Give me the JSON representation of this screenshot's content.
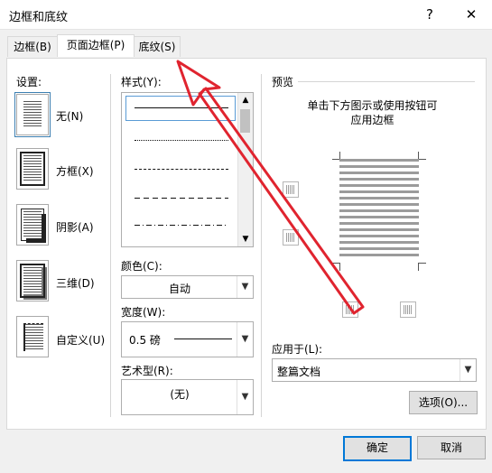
{
  "window": {
    "title": "边框和底纹",
    "help_label": "?",
    "close_label": "✕"
  },
  "tabs": [
    {
      "label": "边框(B)"
    },
    {
      "label": "页面边框(P)"
    },
    {
      "label": "底纹(S)"
    }
  ],
  "settings": {
    "label": "设置:",
    "items": [
      {
        "label": "无(N)",
        "selected": true
      },
      {
        "label": "方框(X)"
      },
      {
        "label": "阴影(A)"
      },
      {
        "label": "三维(D)"
      },
      {
        "label": "自定义(U)"
      }
    ]
  },
  "style": {
    "label": "样式(Y):"
  },
  "color": {
    "label": "颜色(C):",
    "value": "自动"
  },
  "width": {
    "label": "宽度(W):",
    "value": "0.5 磅"
  },
  "art": {
    "label": "艺术型(R):",
    "value": "(无)"
  },
  "preview": {
    "label": "预览",
    "instruction_line1": "单击下方图示或使用按钮可",
    "instruction_line2": "应用边框"
  },
  "apply_to": {
    "label": "应用于(L):",
    "value": "整篇文档"
  },
  "options_button": "选项(O)...",
  "ok_button": "确定",
  "cancel_button": "取消",
  "colors": {
    "annotation_arrow": "#e0242f",
    "focus_blue": "#0078d7"
  }
}
